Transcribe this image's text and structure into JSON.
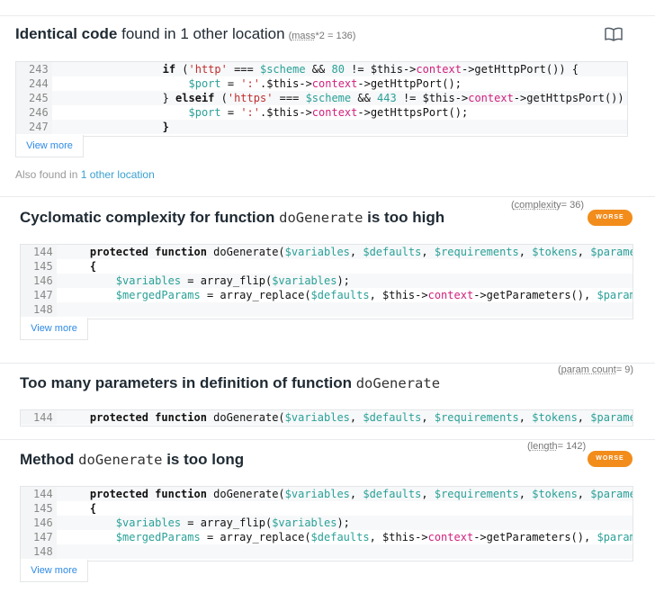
{
  "issues": {
    "dup": {
      "title_bold": "Identical code",
      "title_rest": " found in 1 other location",
      "mass_label": "mass",
      "mass_value": "*2 = 136)",
      "mass_open": "(",
      "view_more": "View more",
      "also_prefix": "Also found in ",
      "also_link": "1 other location",
      "lines": [
        {
          "n": "243",
          "code": [
            {
              "t": "                ",
              "c": ""
            },
            {
              "t": "if",
              "c": "kw"
            },
            {
              "t": " (",
              "c": ""
            },
            {
              "t": "'http'",
              "c": "str"
            },
            {
              "t": " === ",
              "c": ""
            },
            {
              "t": "$scheme",
              "c": "var"
            },
            {
              "t": " && ",
              "c": ""
            },
            {
              "t": "80",
              "c": "num"
            },
            {
              "t": " != $this->",
              "c": ""
            },
            {
              "t": "context",
              "c": "prop"
            },
            {
              "t": "->getHttpPort()) {",
              "c": ""
            }
          ]
        },
        {
          "n": "244",
          "code": [
            {
              "t": "                    ",
              "c": ""
            },
            {
              "t": "$port",
              "c": "var"
            },
            {
              "t": " = ",
              "c": ""
            },
            {
              "t": "':'",
              "c": "str"
            },
            {
              "t": ".$this->",
              "c": ""
            },
            {
              "t": "context",
              "c": "prop"
            },
            {
              "t": "->getHttpPort();",
              "c": ""
            }
          ]
        },
        {
          "n": "245",
          "code": [
            {
              "t": "                } ",
              "c": ""
            },
            {
              "t": "elseif",
              "c": "kw"
            },
            {
              "t": " (",
              "c": ""
            },
            {
              "t": "'https'",
              "c": "str"
            },
            {
              "t": " === ",
              "c": ""
            },
            {
              "t": "$scheme",
              "c": "var"
            },
            {
              "t": " && ",
              "c": ""
            },
            {
              "t": "443",
              "c": "num"
            },
            {
              "t": " != $this->",
              "c": ""
            },
            {
              "t": "context",
              "c": "prop"
            },
            {
              "t": "->getHttpsPort())",
              "c": ""
            }
          ]
        },
        {
          "n": "246",
          "code": [
            {
              "t": "                    ",
              "c": ""
            },
            {
              "t": "$port",
              "c": "var"
            },
            {
              "t": " = ",
              "c": ""
            },
            {
              "t": "':'",
              "c": "str"
            },
            {
              "t": ".$this->",
              "c": ""
            },
            {
              "t": "context",
              "c": "prop"
            },
            {
              "t": "->getHttpsPort();",
              "c": ""
            }
          ]
        },
        {
          "n": "247",
          "code": [
            {
              "t": "                }",
              "c": "kw"
            }
          ]
        }
      ]
    },
    "complexity": {
      "title_bold": "Cyclomatic complexity for function ",
      "title_code": "doGenerate",
      "title_end": " is too high",
      "meta_label": "complexity",
      "meta_value": "= 36)",
      "meta_open": "(",
      "badge": "WORSE",
      "view_more": "View more"
    },
    "params": {
      "title_bold": "Too many parameters in definition of function ",
      "title_code": "doGenerate",
      "meta_label": "param count",
      "meta_value": "= 9)",
      "meta_open": "("
    },
    "long": {
      "title_bold": "Method ",
      "title_code": "doGenerate",
      "title_end": " is too long",
      "meta_label": "length",
      "meta_value": "= 142)",
      "meta_open": "(",
      "badge": "WORSE",
      "view_more": "View more"
    }
  },
  "fn_lines": [
    {
      "n": "144",
      "code": [
        {
          "t": "    ",
          "c": ""
        },
        {
          "t": "protected function",
          "c": "kw"
        },
        {
          "t": " doGenerate(",
          "c": ""
        },
        {
          "t": "$variables",
          "c": "var"
        },
        {
          "t": ", ",
          "c": ""
        },
        {
          "t": "$defaults",
          "c": "var"
        },
        {
          "t": ", ",
          "c": ""
        },
        {
          "t": "$requirements",
          "c": "var"
        },
        {
          "t": ", ",
          "c": ""
        },
        {
          "t": "$tokens",
          "c": "var"
        },
        {
          "t": ", ",
          "c": ""
        },
        {
          "t": "$parameters",
          "c": "var"
        }
      ]
    },
    {
      "n": "145",
      "code": [
        {
          "t": "    {",
          "c": "kw"
        }
      ]
    },
    {
      "n": "146",
      "code": [
        {
          "t": "        ",
          "c": ""
        },
        {
          "t": "$variables",
          "c": "var"
        },
        {
          "t": " = array_flip(",
          "c": ""
        },
        {
          "t": "$variables",
          "c": "var"
        },
        {
          "t": ");",
          "c": ""
        }
      ]
    },
    {
      "n": "147",
      "code": [
        {
          "t": "        ",
          "c": ""
        },
        {
          "t": "$mergedParams",
          "c": "var"
        },
        {
          "t": " = array_replace(",
          "c": ""
        },
        {
          "t": "$defaults",
          "c": "var"
        },
        {
          "t": ", $this->",
          "c": ""
        },
        {
          "t": "context",
          "c": "prop"
        },
        {
          "t": "->getParameters(), ",
          "c": ""
        },
        {
          "t": "$parameters",
          "c": "var"
        }
      ]
    },
    {
      "n": "148",
      "code": []
    }
  ],
  "colors": {
    "accent": "#f28c1b",
    "link": "#2e8ae6",
    "variable": "#2aa198",
    "string": "#c02f2f",
    "property": "#d2217d"
  },
  "icons": {
    "docs": "book-icon"
  }
}
